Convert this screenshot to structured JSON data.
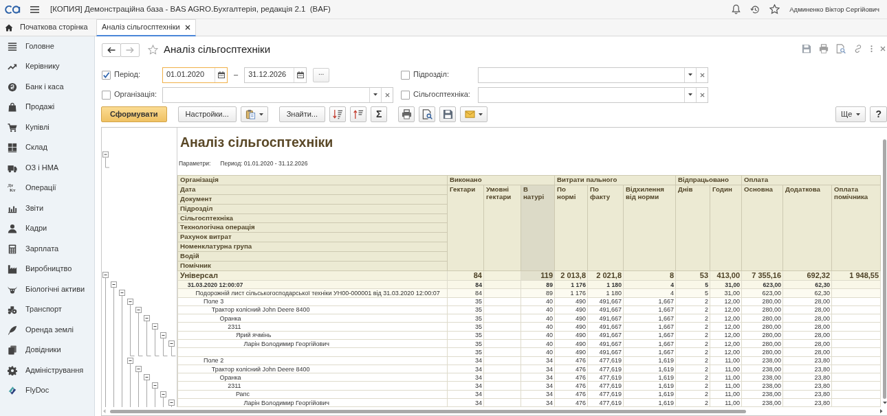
{
  "app_bar": {
    "title": "[КОПИЯ] Демонстраційна база - BAS AGRO.Бухгалтерія, редакція 2.1  (BAF)",
    "user": "Админенко Віктор Сергійович"
  },
  "tabs": [
    {
      "label": "Початкова сторінка",
      "kind": "home",
      "selected": false
    },
    {
      "label": "Аналіз сільгосптехніки",
      "kind": "form",
      "selected": true
    }
  ],
  "sidebar": [
    {
      "label": "Головне",
      "selected": false
    },
    {
      "label": "Керівнику",
      "selected": false
    },
    {
      "label": "Банк і каса",
      "selected": false
    },
    {
      "label": "Продажі",
      "selected": false
    },
    {
      "label": "Купівлі",
      "selected": false
    },
    {
      "label": "Склад",
      "selected": false
    },
    {
      "label": "ОЗ і НМА",
      "selected": false
    },
    {
      "label": "Операції",
      "icon_text": [
        "Дт",
        "Кт"
      ],
      "selected": false
    },
    {
      "label": "Звіти",
      "selected": false
    },
    {
      "label": "Кадри",
      "selected": false
    },
    {
      "label": "Зарплата",
      "selected": false
    },
    {
      "label": "Виробництво",
      "selected": false
    },
    {
      "label": "Біологічні активи",
      "selected": false
    },
    {
      "label": "Транспорт",
      "selected": false
    },
    {
      "label": "Оренда землі",
      "selected": false
    },
    {
      "label": "Довідники",
      "selected": false
    },
    {
      "label": "Адміністрування",
      "selected": false
    },
    {
      "label": "FlyDoc",
      "selected": false
    }
  ],
  "form": {
    "nav": [
      {
        "kind": "back",
        "disabled": false
      },
      {
        "kind": "forward",
        "disabled": true
      }
    ],
    "favorite": false,
    "title": "Аналіз сільгосптехніки",
    "filters": [
      {
        "kind": "period",
        "label": "Період:",
        "checked": true,
        "from": {
          "value": "01.01.2020",
          "focused": true
        },
        "dash": "–",
        "to": {
          "value": "31.12.2026",
          "focused": false
        },
        "more": "..."
      },
      {
        "kind": "select",
        "label": "Підрозділ:",
        "checked": false
      },
      {
        "kind": "select",
        "label": "Організація:",
        "checked": false
      },
      {
        "kind": "select",
        "label": "Сільгосптехніка:",
        "checked": false
      }
    ],
    "toolbar": {
      "groups": [
        [
          {
            "kind": "primary",
            "label": "Сформувати"
          }
        ],
        [
          {
            "kind": "text",
            "label": "Настройки..."
          },
          {
            "kind": "paste"
          }
        ],
        [
          {
            "kind": "text",
            "label": "Знайти..."
          },
          {
            "kind": "sortdown"
          },
          {
            "kind": "sortup"
          },
          {
            "kind": "symbol",
            "label": "Σ"
          }
        ],
        [
          {
            "kind": "print"
          },
          {
            "kind": "preview"
          },
          {
            "kind": "save"
          },
          {
            "kind": "mail"
          }
        ]
      ],
      "right": [
        {
          "kind": "menu",
          "label": "Ще"
        },
        {
          "kind": "symbol",
          "label": "?"
        }
      ]
    }
  },
  "report": {
    "title": "Аналіз сільгосптехніки",
    "parameters": {
      "label": "Параметри:",
      "value": "Период: 01.01.2020 - 31.12.2026"
    },
    "header_expanded": true,
    "row_headers": [
      "Організація",
      "Дата",
      "Документ",
      "Підрозділ",
      "Сільгосптехніка",
      "Технологічна операція",
      "Рахунок витрат",
      "Номенклатурна група",
      "Водій",
      "Помічник"
    ],
    "column_groups": [
      {
        "label": "Виконано",
        "columns": [
          {
            "label": "Гектари",
            "selected": false
          },
          {
            "label": "Умовні\nгектари",
            "selected": false
          },
          {
            "label": "В\nнатурі",
            "selected": true
          }
        ]
      },
      {
        "label": "Витрати пального",
        "columns": [
          {
            "label": "По\nнормі",
            "selected": false
          },
          {
            "label": "По\nфакту",
            "selected": false
          },
          {
            "label": "Відхилення\nвід норми",
            "selected": false
          }
        ]
      },
      {
        "label": "Відпрацьовано",
        "columns": [
          {
            "label": "Днів",
            "selected": false
          },
          {
            "label": "Годин",
            "selected": false
          }
        ]
      },
      {
        "label": "Оплата",
        "columns": [
          {
            "label": "Основна",
            "selected": false
          },
          {
            "label": "Додаткова",
            "selected": false
          },
          {
            "label": "Оплата\nпомічника",
            "selected": false
          }
        ]
      }
    ],
    "rows": [
      {
        "label": "Універсал",
        "expanded": true,
        "selected": true,
        "values": {
          "hectares": "84",
          "in_kind": "119",
          "fuel_norm": "2 013,8",
          "fuel_actual": "2 021,8",
          "fuel_deviation": "8",
          "days": "53",
          "hours": "413,00",
          "pay_basic": "7 355,16",
          "pay_additional": "692,32",
          "pay_assistant": "1 948,55"
        },
        "children": [
          {
            "label": "31.03.2020 12:00:07",
            "expanded": true,
            "selected": false,
            "values": {
              "hectares": "84",
              "in_kind": "89",
              "fuel_norm": "1 176",
              "fuel_actual": "1 180",
              "fuel_deviation": "4",
              "days": "5",
              "hours": "31,00",
              "pay_basic": "623,00",
              "pay_additional": "62,30"
            },
            "children": [
              {
                "label": "Подорожній лист сільськогосподарської техніки УН00-000001 від 31.03.2020 12:00:07",
                "expanded": true,
                "selected": false,
                "values": {
                  "hectares": "84",
                  "in_kind": "89",
                  "fuel_norm": "1 176",
                  "fuel_actual": "1 180",
                  "fuel_deviation": "4",
                  "days": "5",
                  "hours": "31,00",
                  "pay_basic": "623,00",
                  "pay_additional": "62,30"
                },
                "children": [
                  {
                    "label": "Поле 3",
                    "expanded": true,
                    "selected": false,
                    "values": {
                      "hectares": "35",
                      "in_kind": "40",
                      "fuel_norm": "490",
                      "fuel_actual": "491,667",
                      "fuel_deviation": "1,667",
                      "days": "2",
                      "hours": "12,00",
                      "pay_basic": "280,00",
                      "pay_additional": "28,00"
                    },
                    "children": [
                      {
                        "label": "Трактор колісний John Deere 8400",
                        "expanded": true,
                        "selected": false,
                        "values": {
                          "hectares": "35",
                          "in_kind": "40",
                          "fuel_norm": "490",
                          "fuel_actual": "491,667",
                          "fuel_deviation": "1,667",
                          "days": "2",
                          "hours": "12,00",
                          "pay_basic": "280,00",
                          "pay_additional": "28,00"
                        },
                        "children": [
                          {
                            "label": "Оранка",
                            "expanded": true,
                            "selected": false,
                            "values": {
                              "hectares": "35",
                              "in_kind": "40",
                              "fuel_norm": "490",
                              "fuel_actual": "491,667",
                              "fuel_deviation": "1,667",
                              "days": "2",
                              "hours": "12,00",
                              "pay_basic": "280,00",
                              "pay_additional": "28,00"
                            },
                            "children": [
                              {
                                "label": "2311",
                                "expanded": true,
                                "selected": false,
                                "values": {
                                  "hectares": "35",
                                  "in_kind": "40",
                                  "fuel_norm": "490",
                                  "fuel_actual": "491,667",
                                  "fuel_deviation": "1,667",
                                  "days": "2",
                                  "hours": "12,00",
                                  "pay_basic": "280,00",
                                  "pay_additional": "28,00"
                                },
                                "children": [
                                  {
                                    "label": "Ярий ячмінь",
                                    "expanded": true,
                                    "selected": false,
                                    "values": {
                                      "hectares": "35",
                                      "in_kind": "40",
                                      "fuel_norm": "490",
                                      "fuel_actual": "491,667",
                                      "fuel_deviation": "1,667",
                                      "days": "2",
                                      "hours": "12,00",
                                      "pay_basic": "280,00",
                                      "pay_additional": "28,00"
                                    },
                                    "children": [
                                      {
                                        "label": "Ларін Володимир Георгійович",
                                        "expanded": true,
                                        "selected": false,
                                        "values": {
                                          "hectares": "35",
                                          "in_kind": "40",
                                          "fuel_norm": "490",
                                          "fuel_actual": "491,667",
                                          "fuel_deviation": "1,667",
                                          "days": "2",
                                          "hours": "12,00",
                                          "pay_basic": "280,00",
                                          "pay_additional": "28,00"
                                        },
                                        "children": [
                                          {
                                            "selected": false,
                                            "values": {
                                              "hectares": "35",
                                              "in_kind": "40",
                                              "fuel_norm": "490",
                                              "fuel_actual": "491,667",
                                              "fuel_deviation": "1,667",
                                              "days": "2",
                                              "hours": "12,00",
                                              "pay_basic": "280,00",
                                              "pay_additional": "28,00"
                                            }
                                          }
                                        ]
                                      }
                                    ]
                                  }
                                ]
                              }
                            ]
                          }
                        ]
                      }
                    ]
                  },
                  {
                    "label": "Поле 2",
                    "expanded": true,
                    "selected": false,
                    "values": {
                      "hectares": "34",
                      "in_kind": "34",
                      "fuel_norm": "476",
                      "fuel_actual": "477,619",
                      "fuel_deviation": "1,619",
                      "days": "2",
                      "hours": "11,00",
                      "pay_basic": "238,00",
                      "pay_additional": "23,80"
                    },
                    "children": [
                      {
                        "label": "Трактор колісний John Deere 8400",
                        "expanded": true,
                        "selected": false,
                        "values": {
                          "hectares": "34",
                          "in_kind": "34",
                          "fuel_norm": "476",
                          "fuel_actual": "477,619",
                          "fuel_deviation": "1,619",
                          "days": "2",
                          "hours": "11,00",
                          "pay_basic": "238,00",
                          "pay_additional": "23,80"
                        },
                        "children": [
                          {
                            "label": "Оранка",
                            "expanded": true,
                            "selected": false,
                            "values": {
                              "hectares": "34",
                              "in_kind": "34",
                              "fuel_norm": "476",
                              "fuel_actual": "477,619",
                              "fuel_deviation": "1,619",
                              "days": "2",
                              "hours": "11,00",
                              "pay_basic": "238,00",
                              "pay_additional": "23,80"
                            },
                            "children": [
                              {
                                "label": "2311",
                                "expanded": true,
                                "selected": false,
                                "values": {
                                  "hectares": "34",
                                  "in_kind": "34",
                                  "fuel_norm": "476",
                                  "fuel_actual": "477,619",
                                  "fuel_deviation": "1,619",
                                  "days": "2",
                                  "hours": "11,00",
                                  "pay_basic": "238,00",
                                  "pay_additional": "23,80"
                                },
                                "children": [
                                  {
                                    "label": "Рапс",
                                    "expanded": true,
                                    "selected": false,
                                    "values": {
                                      "hectares": "34",
                                      "in_kind": "34",
                                      "fuel_norm": "476",
                                      "fuel_actual": "477,619",
                                      "fuel_deviation": "1,619",
                                      "days": "2",
                                      "hours": "11,00",
                                      "pay_basic": "238,00",
                                      "pay_additional": "23,80"
                                    },
                                    "children": [
                                      {
                                        "label": "Ларін Володимир Георгійович",
                                        "expanded": true,
                                        "selected": false,
                                        "values": {
                                          "hectares": "34",
                                          "in_kind": "34",
                                          "fuel_norm": "476",
                                          "fuel_actual": "477,619",
                                          "fuel_deviation": "1,619",
                                          "days": "2",
                                          "hours": "11,00",
                                          "pay_basic": "238,00",
                                          "pay_additional": "23,80"
                                        }
                                      }
                                    ]
                                  }
                                ]
                              }
                            ]
                          }
                        ]
                      }
                    ]
                  }
                ]
              }
            ]
          }
        ]
      }
    ]
  }
}
